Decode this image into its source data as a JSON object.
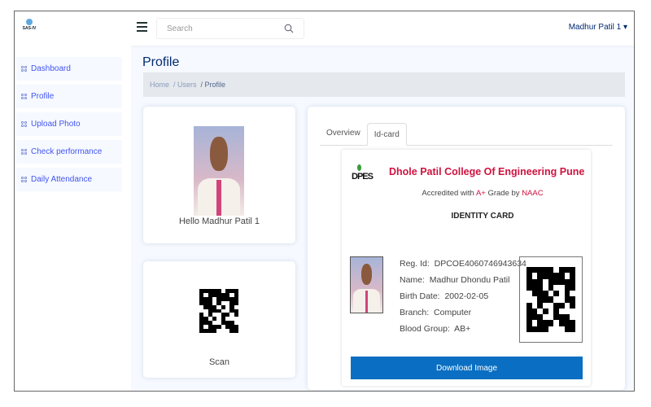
{
  "header": {
    "logo_text": "SAS-IV",
    "search_placeholder": "Search",
    "user_name": "Madhur Patil 1 ▾"
  },
  "sidebar": {
    "items": [
      {
        "label": "Dashboard"
      },
      {
        "label": "Profile"
      },
      {
        "label": "Upload Photo"
      },
      {
        "label": "Check performance"
      },
      {
        "label": "Daily Attendance"
      }
    ]
  },
  "page": {
    "title": "Profile",
    "breadcrumb": [
      "Home",
      "/ Users",
      "/ Profile"
    ]
  },
  "profile_card": {
    "greeting": "Hello Madhur Patil 1"
  },
  "scan_card": {
    "label": "Scan"
  },
  "tabs": [
    {
      "label": "Overview",
      "active": false
    },
    {
      "label": "Id-card",
      "active": true
    }
  ],
  "id_card": {
    "logo_text": "DPES",
    "college": "Dhole Patil College Of Engineering Pune",
    "accr_prefix": "Accredited with ",
    "accr_grade": "A+",
    "accr_mid": " Grade by ",
    "accr_body": "NAAC",
    "heading": "IDENTITY CARD",
    "fields": [
      {
        "label": "Reg. Id:",
        "value": "DPCOE4060746943634"
      },
      {
        "label": "Name:",
        "value": "Madhur Dhondu Patil"
      },
      {
        "label": "Birth Date:",
        "value": "2002-02-05"
      },
      {
        "label": "Branch:",
        "value": "Computer"
      },
      {
        "label": "Blood Group:",
        "value": "AB+"
      }
    ],
    "download_label": "Download Image"
  },
  "colors": {
    "accent": "#4154f1",
    "college_red": "#d0123f",
    "button": "#0a6fc2",
    "title": "#012970"
  }
}
